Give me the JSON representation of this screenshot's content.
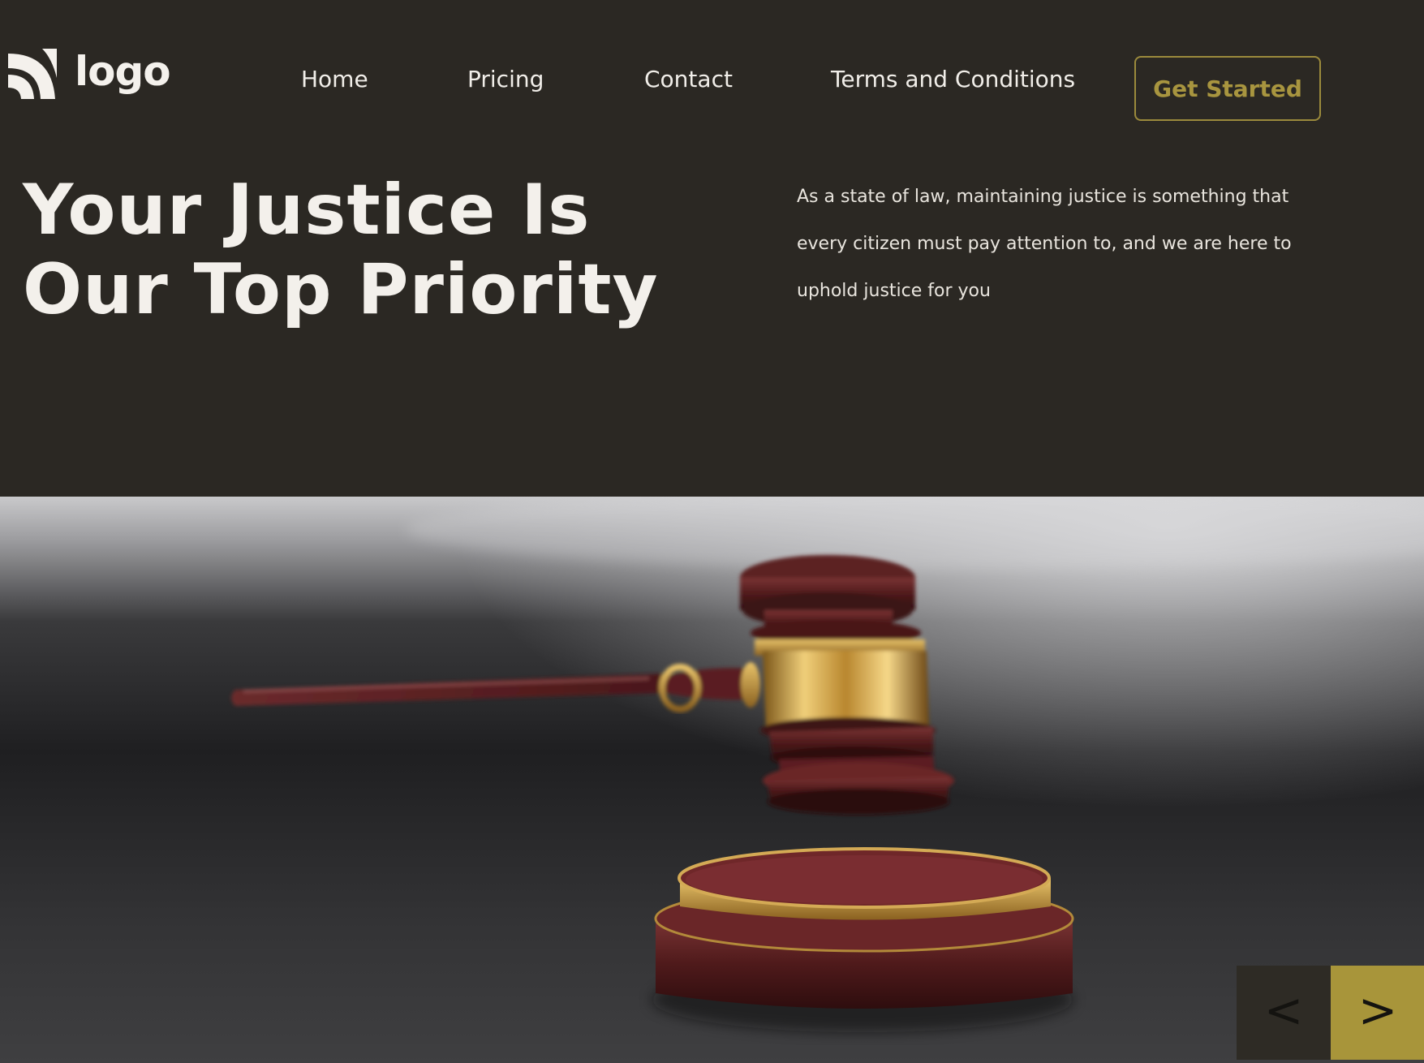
{
  "header": {
    "logo_text": "logo",
    "nav": {
      "home": "Home",
      "pricing": "Pricing",
      "contact": "Contact",
      "terms": "Terms and Conditions"
    },
    "cta_label": "Get Started"
  },
  "hero": {
    "title_line1": "Your Justice Is",
    "title_line2": "Our Top Priority",
    "description": "As a state of law, maintaining justice is something that every citizen must pay attention to, and we are here to uphold justice for you",
    "image_subject": "gavel-icon"
  },
  "slider": {
    "prev_label": "<",
    "next_label": ">"
  },
  "colors": {
    "background": "#2b2823",
    "accent_gold": "#a8953a",
    "text_light": "#f3f0eb",
    "gavel_wood": "#5a1e1e",
    "gavel_brass": "#c8a04a"
  }
}
